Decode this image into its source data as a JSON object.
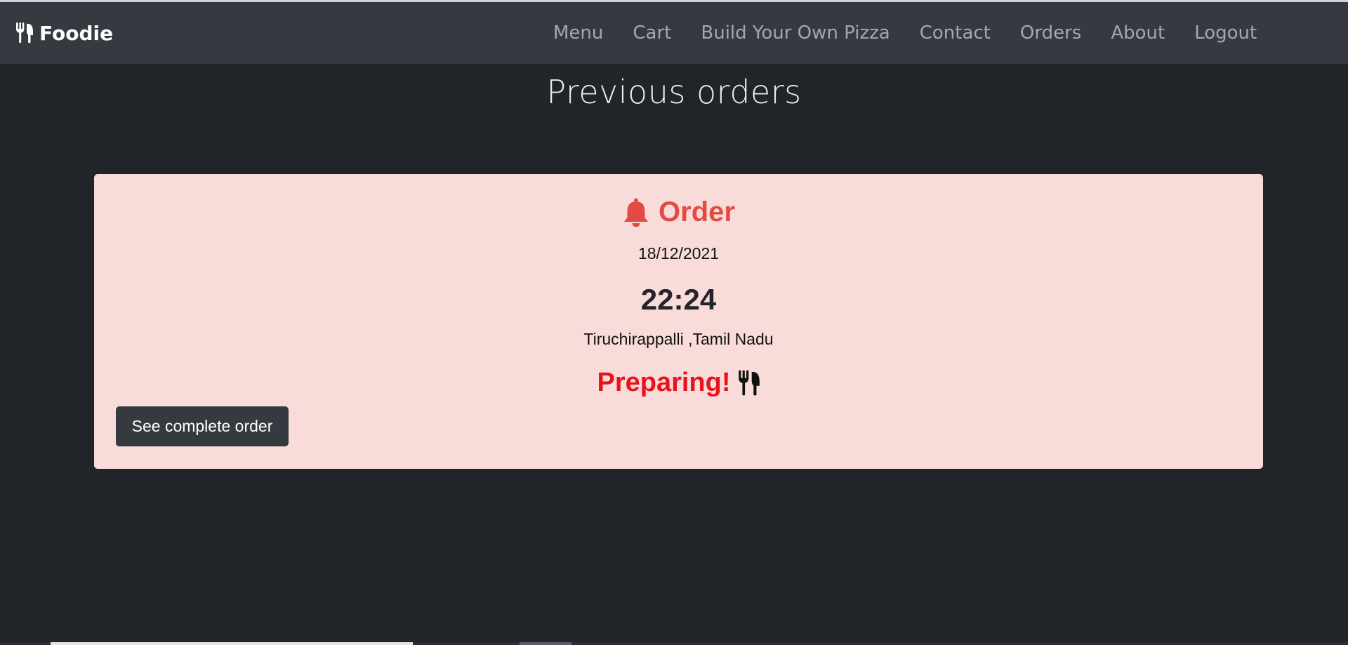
{
  "navbar": {
    "brand": "Foodie",
    "links": [
      "Menu",
      "Cart",
      "Build Your Own Pizza",
      "Contact",
      "Orders",
      "About",
      "Logout"
    ]
  },
  "page": {
    "title": "Previous orders"
  },
  "order": {
    "heading": "Order",
    "date": "18/12/2021",
    "time": "22:24",
    "address": "Tiruchirappalli ,Tamil Nadu",
    "status": "Preparing!",
    "button": "See complete order"
  },
  "icons": {
    "brand": "utensils-icon",
    "heading": "bell-icon",
    "status": "utensils-icon"
  },
  "colors": {
    "background": "#212529",
    "navbar": "#343a40",
    "card": "#f9dcda",
    "heading": "#e24b42",
    "status": "#e8131a",
    "button": "#343a40"
  }
}
